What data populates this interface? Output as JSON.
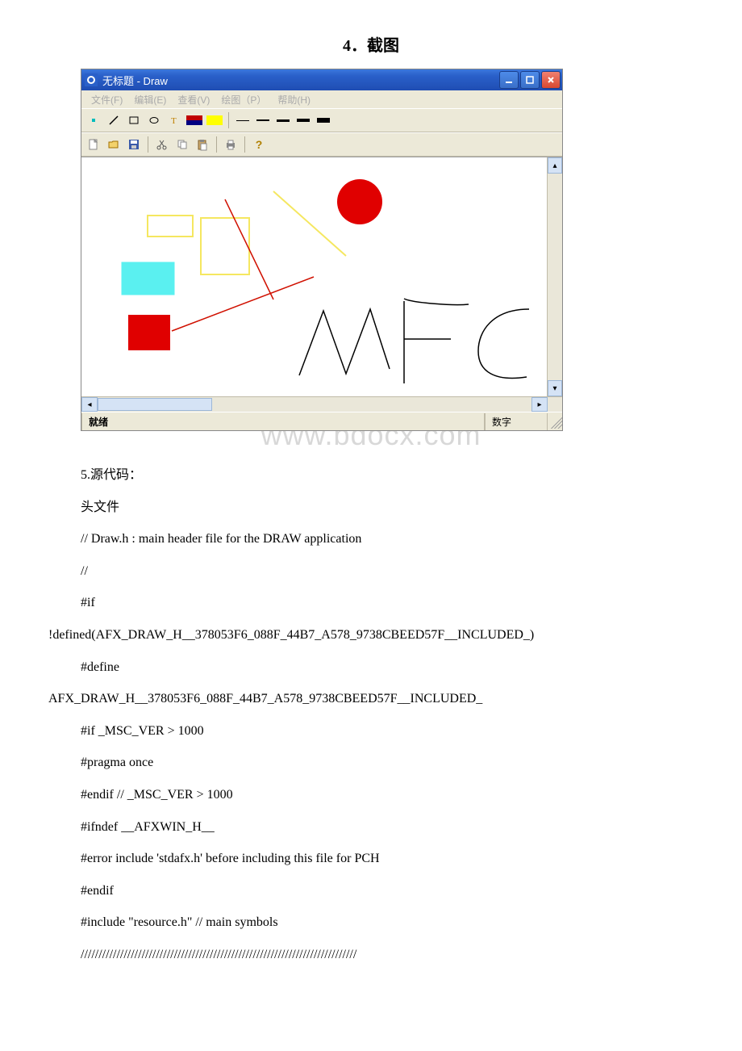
{
  "section_title": "4．截图",
  "watermark": "www.bdocx.com",
  "app": {
    "title": "无标题 - Draw",
    "menu": {
      "file": "文件(F)",
      "edit": "编辑(E)",
      "view": "查看(V)",
      "draw": "绘图（P）",
      "help": "帮助(H)"
    },
    "status": {
      "ready": "就绪",
      "num": "数字"
    }
  },
  "body": {
    "lines": [
      "5.源代码：",
      " 头文件",
      "// Draw.h : main header file for the DRAW application",
      "//"
    ],
    "ifblock": {
      "p1a": "#if",
      "p1b": "!defined(AFX_DRAW_H__378053F6_088F_44B7_A578_9738CBEED57F__INCLUDED_)",
      "p2a": "#define",
      "p2b": "AFX_DRAW_H__378053F6_088F_44B7_A578_9738CBEED57F__INCLUDED_"
    },
    "tail": [
      "#if _MSC_VER > 1000",
      "#pragma once",
      "#endif // _MSC_VER > 1000",
      "#ifndef __AFXWIN_H__",
      " #error include 'stdafx.h' before including this file for PCH",
      "#endif",
      "#include \"resource.h\" // main symbols",
      "/////////////////////////////////////////////////////////////////////////////"
    ]
  }
}
